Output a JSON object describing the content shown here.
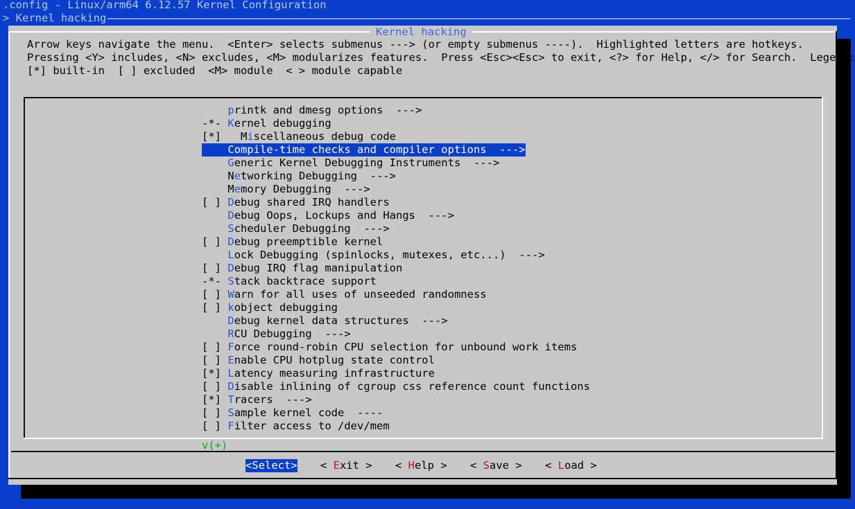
{
  "window": {
    "title": ".config - Linux/arm64 6.12.57 Kernel Configuration",
    "breadcrumb": "> Kernel hacking"
  },
  "dialog": {
    "title": "Kernel hacking",
    "help_lines": [
      "Arrow keys navigate the menu.  <Enter> selects submenus ---> (or empty submenus ----).  Highlighted letters are hotkeys.",
      "Pressing <Y> includes, <N> excludes, <M> modularizes features.  Press <Esc><Esc> to exit, <?> for Help, </> for Search.  Legend:",
      "[*] built-in  [ ] excluded  <M> module  < > module capable"
    ]
  },
  "menu": {
    "selected_index": 3,
    "more_indicator": "v(+)",
    "items": [
      {
        "state": "   ",
        "lead": "",
        "hotkey": "p",
        "rest": "rintk and dmesg options  --->"
      },
      {
        "state": "-*-",
        "lead": "",
        "hotkey": "K",
        "rest": "ernel debugging"
      },
      {
        "state": "[*]",
        "lead": "  M",
        "hotkey": "i",
        "rest": "scellaneous debug code"
      },
      {
        "state": "   ",
        "lead": "",
        "hotkey": "C",
        "rest": "ompile-time checks and compiler options  --->"
      },
      {
        "state": "   ",
        "lead": "",
        "hotkey": "G",
        "rest": "eneric Kernel Debugging Instruments  --->"
      },
      {
        "state": "   ",
        "lead": "N",
        "hotkey": "e",
        "rest": "tworking Debugging  --->"
      },
      {
        "state": "   ",
        "lead": "M",
        "hotkey": "e",
        "rest": "mory Debugging  --->"
      },
      {
        "state": "[ ]",
        "lead": "",
        "hotkey": "D",
        "rest": "ebug shared IRQ handlers"
      },
      {
        "state": "   ",
        "lead": "",
        "hotkey": "D",
        "rest": "ebug Oops, Lockups and Hangs  --->"
      },
      {
        "state": "   ",
        "lead": "",
        "hotkey": "S",
        "rest": "cheduler Debugging  --->"
      },
      {
        "state": "[ ]",
        "lead": "",
        "hotkey": "D",
        "rest": "ebug preemptible kernel"
      },
      {
        "state": "   ",
        "lead": "",
        "hotkey": "L",
        "rest": "ock Debugging (spinlocks, mutexes, etc...)  --->"
      },
      {
        "state": "[ ]",
        "lead": "",
        "hotkey": "D",
        "rest": "ebug IRQ flag manipulation"
      },
      {
        "state": "-*-",
        "lead": "",
        "hotkey": "S",
        "rest": "tack backtrace support"
      },
      {
        "state": "[ ]",
        "lead": "",
        "hotkey": "W",
        "rest": "arn for all uses of unseeded randomness"
      },
      {
        "state": "[ ]",
        "lead": "",
        "hotkey": "k",
        "rest": "object debugging"
      },
      {
        "state": "   ",
        "lead": "",
        "hotkey": "D",
        "rest": "ebug kernel data structures  --->"
      },
      {
        "state": "   ",
        "lead": "",
        "hotkey": "R",
        "rest": "CU Debugging  --->"
      },
      {
        "state": "[ ]",
        "lead": "",
        "hotkey": "F",
        "rest": "orce round-robin CPU selection for unbound work items"
      },
      {
        "state": "[ ]",
        "lead": "",
        "hotkey": "E",
        "rest": "nable CPU hotplug state control"
      },
      {
        "state": "[*]",
        "lead": "",
        "hotkey": "L",
        "rest": "atency measuring infrastructure"
      },
      {
        "state": "[ ]",
        "lead": "",
        "hotkey": "D",
        "rest": "isable inlining of cgroup css reference count functions"
      },
      {
        "state": "[*]",
        "lead": "",
        "hotkey": "T",
        "rest": "racers  --->"
      },
      {
        "state": "[ ]",
        "lead": "",
        "hotkey": "S",
        "rest": "ample kernel code  ----"
      },
      {
        "state": "[ ]",
        "lead": "",
        "hotkey": "F",
        "rest": "ilter access to /dev/mem"
      }
    ]
  },
  "buttons": [
    {
      "pre": "<",
      "hotkey": "S",
      "rest": "elect>",
      "active": true
    },
    {
      "pre": "< ",
      "hotkey": "E",
      "rest": "xit >",
      "active": false
    },
    {
      "pre": "< ",
      "hotkey": "H",
      "rest": "elp >",
      "active": false
    },
    {
      "pre": "< ",
      "hotkey": "S",
      "rest": "ave >",
      "active": false
    },
    {
      "pre": "< ",
      "hotkey": "L",
      "rest": "oad >",
      "active": false
    }
  ],
  "colors": {
    "background": "#0a3fcc",
    "dialog": "#c8c8c8",
    "hotkey": "#2d55d0",
    "button_hotkey": "#c01818",
    "more_indicator": "#00b000"
  }
}
